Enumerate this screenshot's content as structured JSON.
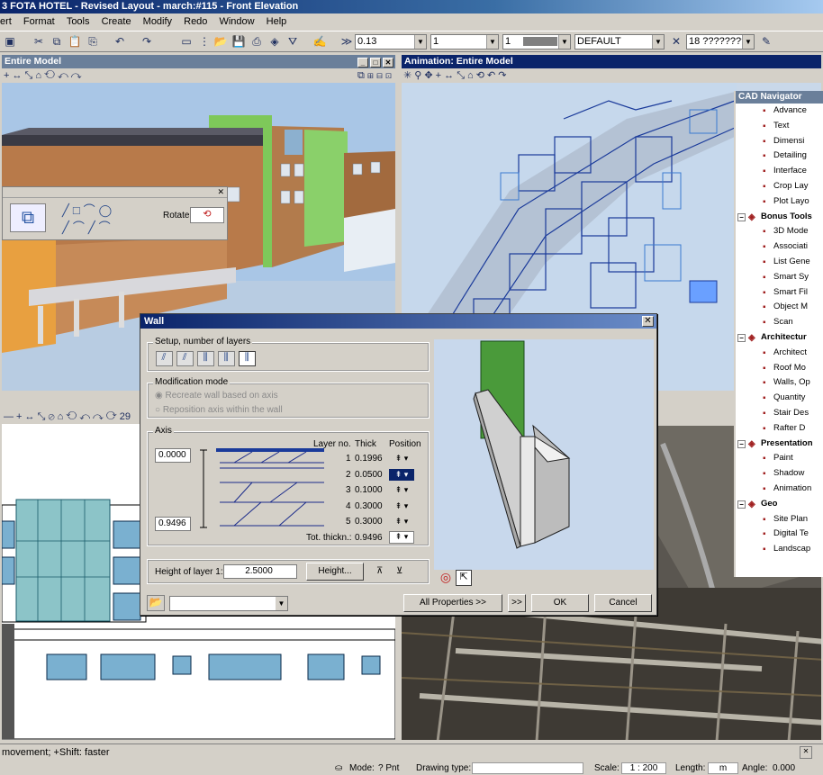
{
  "window": {
    "title": "3 FOTA HOTEL - Revised Layout - march:#115 - Front Elevation"
  },
  "menu": [
    "ert",
    "Format",
    "Tools",
    "Create",
    "Modify",
    "Redo",
    "Window",
    "Help"
  ],
  "toolbar": {
    "line_weight": "0.13",
    "style_value": "1",
    "color_value": "1",
    "layer": "DEFAULT",
    "font": "18 ?????????"
  },
  "views": {
    "top_left": {
      "title": "Entire Model"
    },
    "top_right": {
      "title": "Animation: Entire Model"
    },
    "bottom_left": {
      "zoom_label": "29"
    }
  },
  "palette": {
    "rotate_label": "Rotate"
  },
  "cad_navigator": {
    "title": "CAD Navigator",
    "items": [
      {
        "type": "sub",
        "label": "Advance",
        "icon": "advance-icon"
      },
      {
        "type": "sub",
        "label": "Text",
        "icon": "text-icon"
      },
      {
        "type": "sub",
        "label": "Dimensi",
        "icon": "dimension-icon"
      },
      {
        "type": "sub",
        "label": "Detailing",
        "icon": "detailing-icon"
      },
      {
        "type": "sub",
        "label": "Interface",
        "icon": "interface-icon"
      },
      {
        "type": "sub",
        "label": "Crop Lay",
        "icon": "crop-layout-icon"
      },
      {
        "type": "sub",
        "label": "Plot Layo",
        "icon": "plot-layout-icon"
      },
      {
        "type": "grp",
        "label": "Bonus Tools",
        "icon": "bonus-tools-icon"
      },
      {
        "type": "sub",
        "label": "3D Mode",
        "icon": "3d-model-icon"
      },
      {
        "type": "sub",
        "label": "Associati",
        "icon": "associative-icon"
      },
      {
        "type": "sub",
        "label": "List Gene",
        "icon": "list-generator-icon"
      },
      {
        "type": "sub",
        "label": "Smart Sy",
        "icon": "smart-symbol-icon"
      },
      {
        "type": "sub",
        "label": "Smart Fil",
        "icon": "smart-fill-icon"
      },
      {
        "type": "sub",
        "label": "Object M",
        "icon": "object-manager-icon"
      },
      {
        "type": "sub",
        "label": "Scan",
        "icon": "scan-icon"
      },
      {
        "type": "grp",
        "label": "Architectur",
        "icon": "architecture-icon"
      },
      {
        "type": "sub",
        "label": "Architect",
        "icon": "architect-icon"
      },
      {
        "type": "sub",
        "label": "Roof Mo",
        "icon": "roof-modeler-icon"
      },
      {
        "type": "sub",
        "label": "Walls, Op",
        "icon": "walls-openings-icon"
      },
      {
        "type": "sub",
        "label": "Quantity",
        "icon": "quantity-icon"
      },
      {
        "type": "sub",
        "label": "Stair Des",
        "icon": "stair-designer-icon"
      },
      {
        "type": "sub",
        "label": "Rafter D",
        "icon": "rafter-designer-icon"
      },
      {
        "type": "grp",
        "label": "Presentation",
        "icon": "presentation-icon"
      },
      {
        "type": "sub",
        "label": "Paint",
        "icon": "paint-icon"
      },
      {
        "type": "sub",
        "label": "Shadow",
        "icon": "shadow-icon"
      },
      {
        "type": "sub",
        "label": "Animation",
        "icon": "animation-icon"
      },
      {
        "type": "grp",
        "label": "Geo",
        "icon": "geo-icon"
      },
      {
        "type": "sub",
        "label": "Site Plan",
        "icon": "site-plan-icon"
      },
      {
        "type": "sub",
        "label": "Digital Te",
        "icon": "digital-terrain-icon"
      },
      {
        "type": "sub",
        "label": "Landscap",
        "icon": "landscape-icon"
      }
    ]
  },
  "wall_dialog": {
    "title": "Wall",
    "setup_group": "Setup, number of layers",
    "modification_group": "Modification mode",
    "mode_options": [
      "Recreate wall based on axis",
      "Reposition axis within the wall"
    ],
    "axis_group": "Axis",
    "axis_top": "0.0000",
    "axis_bottom": "0.9496",
    "col_layer_no": "Layer no.",
    "col_thick": "Thick",
    "col_position": "Position",
    "layers": [
      {
        "no": "1",
        "thick": "0.1996"
      },
      {
        "no": "2",
        "thick": "0.0500"
      },
      {
        "no": "3",
        "thick": "0.1000"
      },
      {
        "no": "4",
        "thick": "0.3000"
      },
      {
        "no": "5",
        "thick": "0.3000"
      }
    ],
    "total_label": "Tot. thickn.:",
    "total_value": "0.9496",
    "height_label": "Height of layer 1:",
    "height_value": "2.5000",
    "height_button": "Height...",
    "all_properties_button": "All Properties >>",
    "more_button": ">>",
    "ok_button": "OK",
    "cancel_button": "Cancel",
    "layer_colors": {
      "core": "#4a9a3a",
      "faces": "#c8c8c8",
      "background": "#c8d8ec"
    }
  },
  "status": {
    "hint": "movement; +Shift: faster",
    "mode_label": "Mode:",
    "mode_value": "? Pnt",
    "drawing_type_label": "Drawing type:",
    "scale_label": "Scale:",
    "scale_value": "1 : 200",
    "length_label": "Length:",
    "length_unit": "m",
    "angle_label": "Angle:",
    "angle_value": "0.000"
  }
}
